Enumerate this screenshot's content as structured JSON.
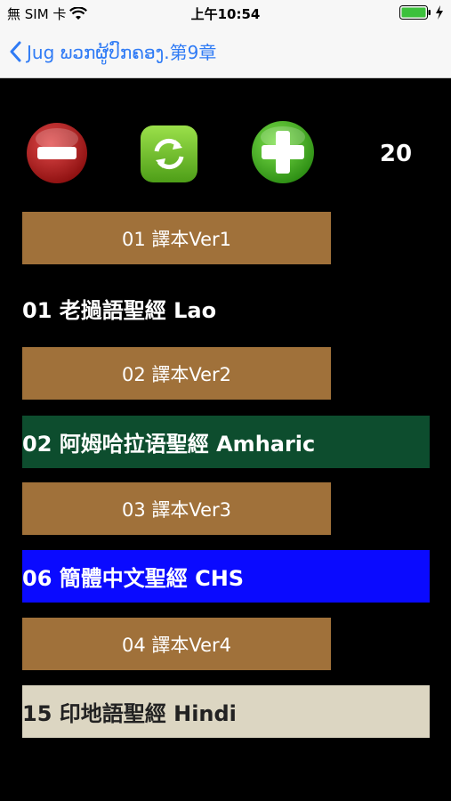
{
  "status": {
    "carrier": "無 SIM 卡",
    "time": "上午10:54"
  },
  "nav": {
    "back_label": "Jug ພວກຜູ້ປົກຄອງ.第9章"
  },
  "controls": {
    "count": "20"
  },
  "list": [
    {
      "kind": "button",
      "label": "01 譯本Ver1"
    },
    {
      "kind": "row",
      "label": "01 老撾語聖經 Lao"
    },
    {
      "kind": "button",
      "label": "02 譯本Ver2"
    },
    {
      "kind": "row",
      "label": "02 阿姆哈拉语聖經 Amharic"
    },
    {
      "kind": "button",
      "label": "03 譯本Ver3"
    },
    {
      "kind": "row",
      "label": "06 簡體中文聖經 CHS"
    },
    {
      "kind": "button",
      "label": "04 譯本Ver4"
    },
    {
      "kind": "row",
      "label": "15 印地語聖經 Hindi"
    }
  ]
}
